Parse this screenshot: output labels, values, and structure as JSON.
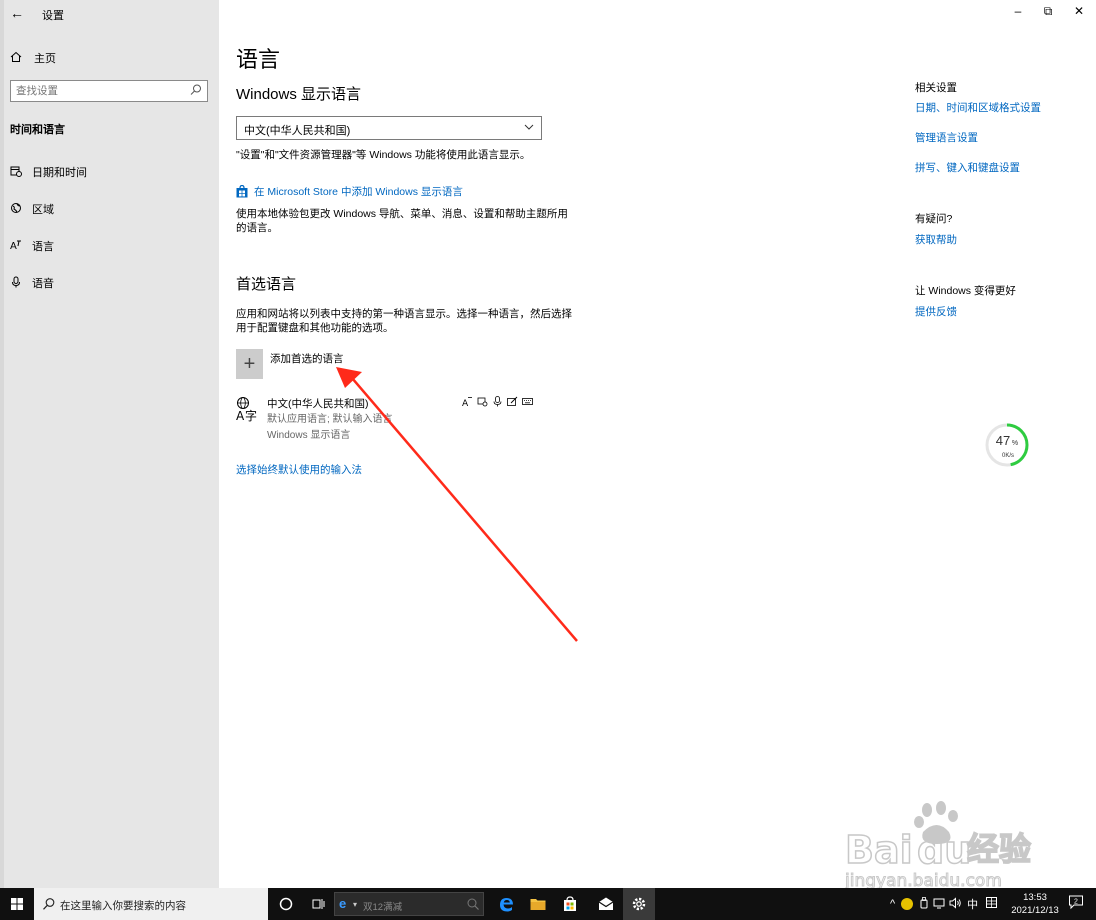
{
  "window": {
    "back_icon": "←",
    "title": "设置",
    "minimize": "–",
    "restore": "⧉",
    "close": "✕"
  },
  "sidebar": {
    "home_label": "主页",
    "search_placeholder": "查找设置",
    "section_title": "时间和语言",
    "items": [
      {
        "label": "日期和时间",
        "icon": "calendar-clock-icon",
        "active": false
      },
      {
        "label": "区域",
        "icon": "globe-region-icon",
        "active": false
      },
      {
        "label": "语言",
        "icon": "language-icon",
        "active": true
      },
      {
        "label": "语音",
        "icon": "microphone-icon",
        "active": false
      }
    ]
  },
  "main": {
    "page_title": "语言",
    "display_language": {
      "heading": "Windows 显示语言",
      "selected": "中文(中华人民共和国)",
      "note": "\"设置\"和\"文件资源管理器\"等 Windows 功能将使用此语言显示。",
      "store_link": "在 Microsoft Store 中添加 Windows 显示语言",
      "store_desc_line1": "使用本地体验包更改 Windows 导航、菜单、消息、设置和帮助主题所用",
      "store_desc_line2": "的语言。"
    },
    "preferred": {
      "heading": "首选语言",
      "desc_line1": "应用和网站将以列表中支持的第一种语言显示。选择一种语言，然后选择",
      "desc_line2": "用于配置键盘和其他功能的选项。",
      "add_label": "添加首选的语言",
      "languages": [
        {
          "name": "中文(中华人民共和国)",
          "sub1": "默认应用语言; 默认输入语言",
          "sub2": "Windows 显示语言"
        }
      ],
      "input_method_link": "选择始终默认使用的输入法"
    }
  },
  "right": {
    "related_heading": "相关设置",
    "related_links": [
      "日期、时间和区域格式设置",
      "管理语言设置",
      "拼写、键入和键盘设置"
    ],
    "question_heading": "有疑问?",
    "help_link": "获取帮助",
    "better_heading": "让 Windows 变得更好",
    "feedback_link": "提供反馈"
  },
  "speed_widget": {
    "percent": "47",
    "percent_sign": "%",
    "rate": "0K/s",
    "value": 0.47
  },
  "watermark": {
    "brand": "Bai",
    "brand2": "du",
    "cn": "经验",
    "url": "jingyan.baidu.com"
  },
  "taskbar": {
    "search_text": "在这里输入你要搜索的内容",
    "address_text": "双12满减",
    "tray_ime": "中",
    "time": "13:53",
    "date": "2021/12/13",
    "notif_count": "2"
  },
  "colors": {
    "accent": "#0067c0",
    "sidebar_bg": "#e6e6e6",
    "arrow": "#ff2a1a",
    "speed_ring": "#2ecc40"
  }
}
